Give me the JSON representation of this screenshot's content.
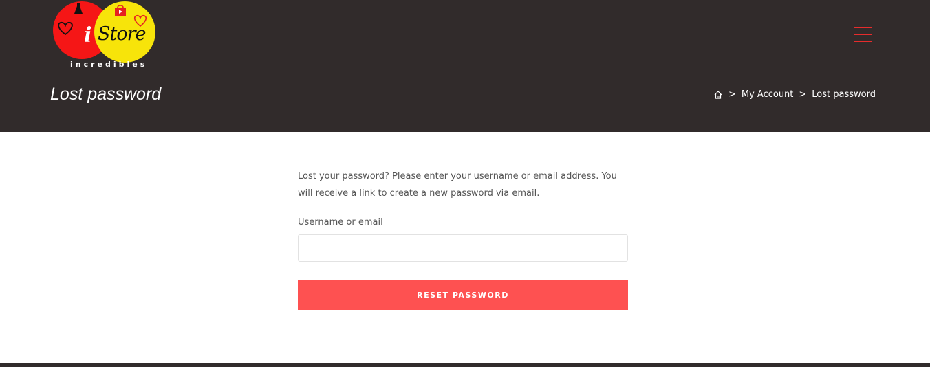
{
  "brand": {
    "logo_letter": "i",
    "logo_word": "Store",
    "logo_tagline": "incredibles",
    "colors": {
      "red": "#f51616",
      "yellow": "#f7e40a"
    }
  },
  "header": {
    "page_title": "Lost password",
    "menu_icon": "hamburger-icon",
    "background": "#312b2b"
  },
  "breadcrumb": {
    "home_icon": "home-icon",
    "separator": ">",
    "items": [
      "My Account",
      "Lost password"
    ]
  },
  "form": {
    "intro": "Lost your password? Please enter your username or email address. You will receive a link to create a new password via email.",
    "username_label": "Username or email",
    "username_value": "",
    "submit_label": "RESET PASSWORD",
    "accent": "#fe5151"
  }
}
